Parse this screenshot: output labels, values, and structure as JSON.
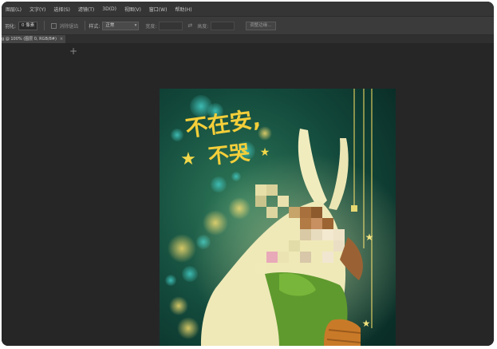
{
  "menubar": {
    "items": [
      "图层(L)",
      "文字(Y)",
      "选择(S)",
      "滤镜(T)",
      "3D(D)",
      "视图(V)",
      "窗口(W)",
      "帮助(H)"
    ]
  },
  "options": {
    "feather_label": "羽化:",
    "feather_value": "0 像素",
    "antialias_label": "消除锯齿",
    "style_label": "样式:",
    "style_value": "正常",
    "width_label": "宽度:",
    "height_label": "高度:",
    "refine_label": "调整边缘..."
  },
  "doc_tab": {
    "label": "g @ 100% (图层 0, RGB/8#)",
    "close": "×"
  },
  "artwork": {
    "text_line1": "不在安,",
    "text_line2": "不哭"
  },
  "icons": [
    "plus-cursor-icon",
    "close-icon",
    "swap-icon",
    "star-icon"
  ]
}
